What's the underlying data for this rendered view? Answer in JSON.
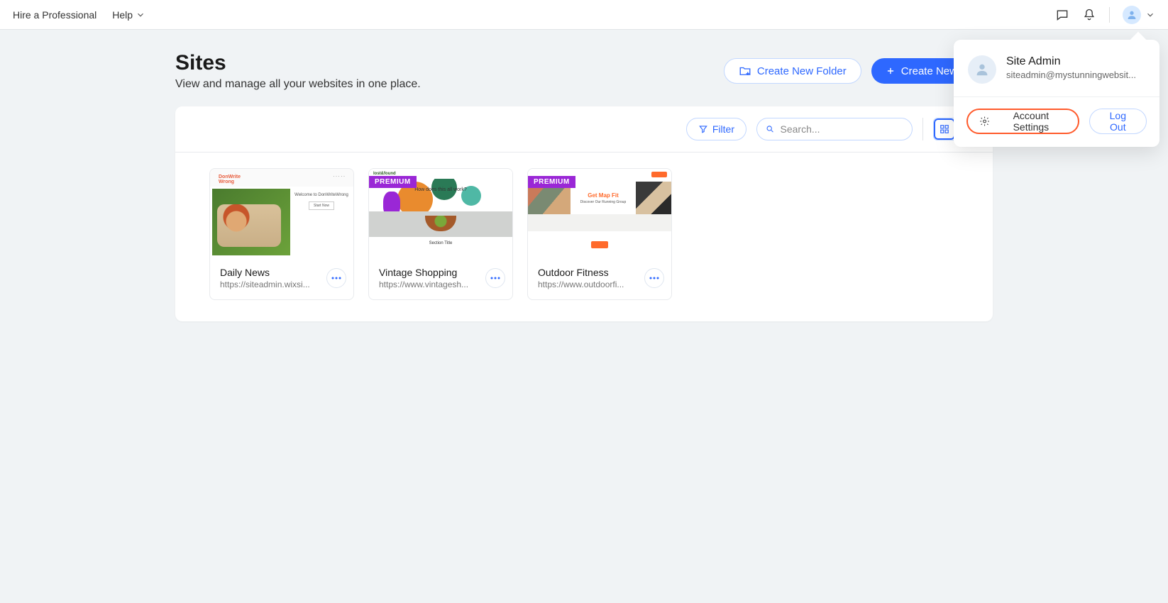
{
  "topbar": {
    "hire_label": "Hire a Professional",
    "help_label": "Help"
  },
  "page": {
    "title": "Sites",
    "subtitle": "View and manage all your websites in one place."
  },
  "actions": {
    "create_folder": "Create New Folder",
    "create_site": "Create New Site"
  },
  "toolbar": {
    "filter": "Filter",
    "search_placeholder": "Search..."
  },
  "sites": [
    {
      "name": "Daily News",
      "url": "https://siteadmin.wixsi...",
      "premium": false
    },
    {
      "name": "Vintage Shopping",
      "url": "https://www.vintagesh...",
      "premium": true
    },
    {
      "name": "Outdoor Fitness",
      "url": "https://www.outdoorfi...",
      "premium": true
    }
  ],
  "premium_badge": "PREMIUM",
  "thumbs": {
    "t1_logo": "DonWrite\nWrong",
    "t1_welcome": "Welcome to DonWriteWrong",
    "t1_btn": "Start Now",
    "t2_logo": "lost&found",
    "t2_question": "How does this all work?",
    "t2_section": "Section Title",
    "t3_headline": "Get Map Fit",
    "t3_sub": "Discover Our Running Group"
  },
  "dropdown": {
    "user_name": "Site Admin",
    "user_email": "siteadmin@mystunningwebsit...",
    "account_settings": "Account Settings",
    "log_out": "Log Out"
  }
}
